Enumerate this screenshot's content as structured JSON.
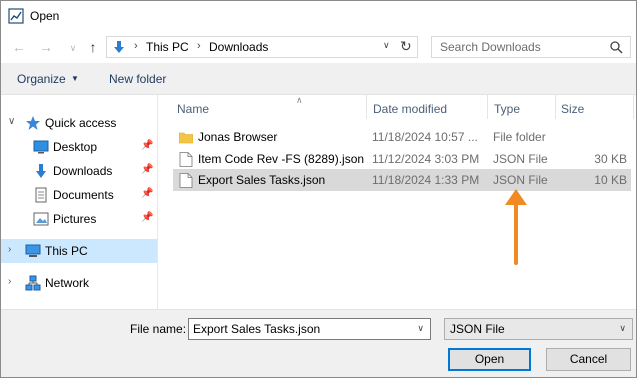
{
  "window": {
    "title": "Open"
  },
  "address": {
    "crumbs": [
      "This PC",
      "Downloads"
    ],
    "search_placeholder": "Search Downloads"
  },
  "toolbar": {
    "organize_label": "Organize",
    "new_folder_label": "New folder"
  },
  "nav": {
    "items": [
      {
        "label": "Quick access"
      },
      {
        "label": "Desktop"
      },
      {
        "label": "Downloads"
      },
      {
        "label": "Documents"
      },
      {
        "label": "Pictures"
      },
      {
        "label": "This PC"
      },
      {
        "label": "Network"
      }
    ]
  },
  "filelist": {
    "columns": {
      "name": "Name",
      "date": "Date modified",
      "type": "Type",
      "size": "Size"
    },
    "rows": [
      {
        "name": "Jonas Browser",
        "date": "11/18/2024 10:57 ...",
        "type": "File folder",
        "size": "",
        "icon": "folder-icon"
      },
      {
        "name": "Item Code Rev -FS (8289).json",
        "date": "11/12/2024 3:03 PM",
        "type": "JSON File",
        "size": "30 KB",
        "icon": "file-icon"
      },
      {
        "name": "Export Sales Tasks.json",
        "date": "11/18/2024 1:33 PM",
        "type": "JSON File",
        "size": "10 KB",
        "icon": "file-icon",
        "selected": true
      }
    ]
  },
  "bottom": {
    "filename_label": "File name:",
    "filename_value": "Export Sales Tasks.json",
    "filetype_value": "JSON File",
    "open_label": "Open",
    "cancel_label": "Cancel"
  },
  "colors": {
    "selection": "#cce8ff",
    "row_selection": "#d9d9d9",
    "annotation_arrow": "#f08a24",
    "accent": "#0078d7"
  }
}
